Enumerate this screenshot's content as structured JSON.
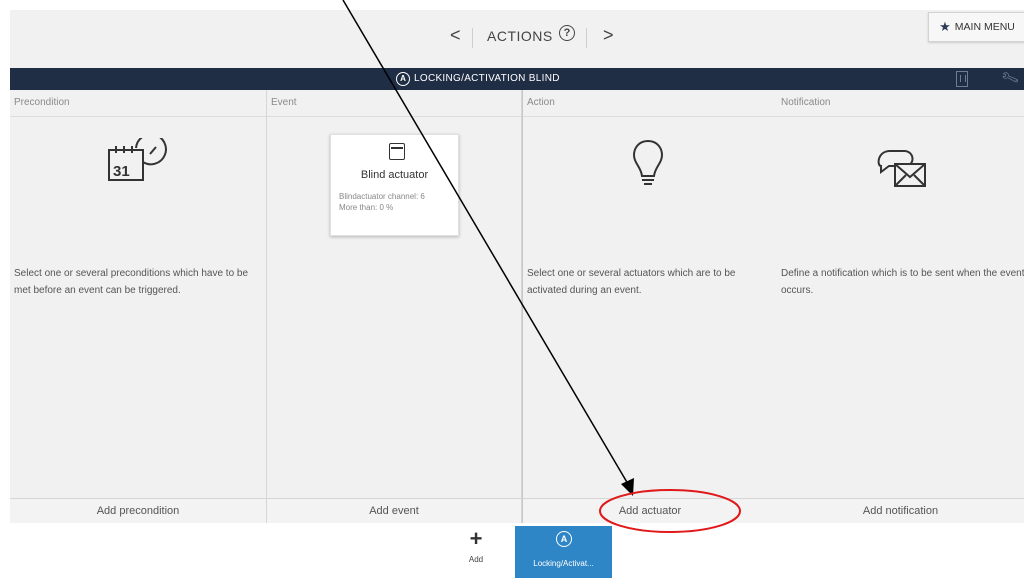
{
  "nav": {
    "prev": "<",
    "title": "ACTIONS",
    "help": "?",
    "next": ">",
    "main_menu": "MAIN MENU"
  },
  "titlebar": {
    "icon_letter": "A",
    "title": "LOCKING/ACTIVATION BLIND"
  },
  "columns": {
    "precondition": {
      "header": "Precondition",
      "calendar_day": "31",
      "description": "Select one or several preconditions which have to be met before an event can be triggered.",
      "footer": "Add precondition"
    },
    "event": {
      "header": "Event",
      "card_title": "Blind actuator",
      "card_line1": "Blindactuator channel: 6",
      "card_line2": "More than: 0 %",
      "footer": "Add event"
    },
    "action": {
      "header": "Action",
      "description": "Select one or several actuators which are to be activated during an event.",
      "footer": "Add actuator"
    },
    "notification": {
      "header": "Notification",
      "description": "Define a notification which is to be sent when the event occurs.",
      "footer": "Add notification"
    }
  },
  "bottom": {
    "add_symbol": "+",
    "add_label": "Add",
    "tab_icon_letter": "A",
    "tab_label": "Locking/Activat..."
  },
  "colors": {
    "titlebar": "#1f2d45",
    "active_tab": "#2f86c6",
    "annotation_circle": "#e0191b"
  }
}
